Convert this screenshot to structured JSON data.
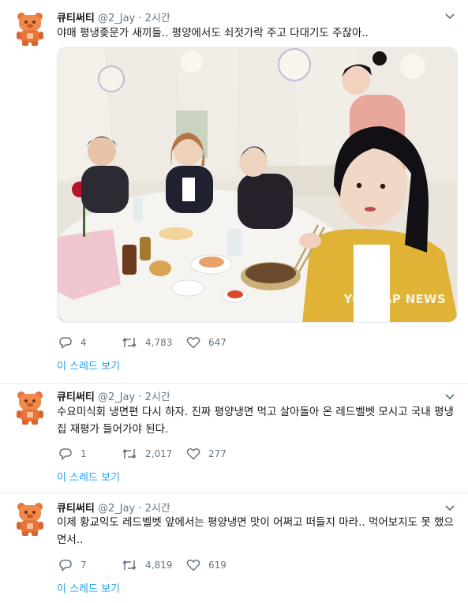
{
  "tweets": [
    {
      "name": "큐티써티",
      "handle": "@2_Jay",
      "time": "· 2시간",
      "text": "야매 평냉좆문가 새끼들.. 평양에서도 쇠젓가락 주고 다대기도 주잖아..",
      "replies": "4",
      "retweets": "4,783",
      "likes": "647",
      "thread_link": "이 스레드 보기",
      "media": {
        "watermark": "YONHAP NEWS"
      }
    },
    {
      "name": "큐티써티",
      "handle": "@2_Jay",
      "time": "· 2시간",
      "text": "수요미식회 냉면편 다시 하자. 진짜 평양냉면 먹고 살아돌아 온 레드벨벳 모시고 국내 평냉집 재평가 들어가야 된다.",
      "replies": "1",
      "retweets": "2,017",
      "likes": "277",
      "thread_link": "이 스레드 보기"
    },
    {
      "name": "큐티써티",
      "handle": "@2_Jay",
      "time": "· 2시간",
      "text": "이제 황교익도 레드벨벳 앞에서는 평양냉면 맛이 어쩌고 떠들지 마라.. 먹어보지도 못 했으면서..",
      "replies": "7",
      "retweets": "4,819",
      "likes": "619",
      "thread_link": "이 스레드 보기"
    }
  ],
  "colors": {
    "link": "#1da1f2",
    "muted": "#657786",
    "avatar": "#e8743b"
  },
  "icons": [
    "bear-avatar-icon",
    "chevron-down-icon",
    "reply-icon",
    "retweet-icon",
    "like-icon"
  ]
}
